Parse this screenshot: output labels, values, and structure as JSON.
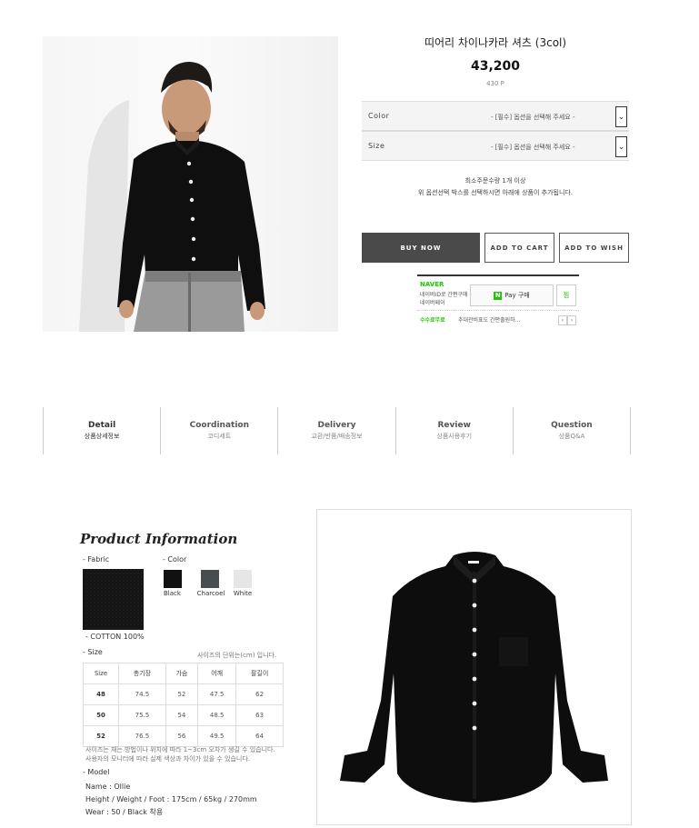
{
  "product": {
    "name": "띠어리 차이나카라 셔츠 (3col)",
    "price": "43,200",
    "points": "430 P"
  },
  "options": [
    {
      "label": "Color",
      "value": "- [필수] 옵션을 선택해 주세요 -"
    },
    {
      "label": "Size",
      "value": "- [필수] 옵션을 선택해 주세요 -"
    }
  ],
  "notice": {
    "line1": "최소주문수량 1개 이상",
    "line2": "위 옵션선택 박스를 선택하시면 아래에 상품이 추가됩니다."
  },
  "buttons": {
    "buy": "BUY NOW",
    "cart": "ADD TO CART",
    "wish": "ADD TO WISH"
  },
  "npay": {
    "brand": "NAVER",
    "line1": "네이버ID로 간편구매",
    "line2": "네이버페이",
    "pay_label": "Pay 구매",
    "pay_n": "N",
    "jjim": "찜",
    "sale_label": "수수료무료",
    "sale_text": "추대관비표도 간편출원하…",
    "prev": "‹",
    "next": "›"
  },
  "tabs": [
    {
      "en": "Detail",
      "ko": "상품상세정보"
    },
    {
      "en": "Coordination",
      "ko": "코디세트"
    },
    {
      "en": "Delivery",
      "ko": "교환/반품/배송정보"
    },
    {
      "en": "Review",
      "ko": "상품사용후기"
    },
    {
      "en": "Question",
      "ko": "상품Q&A"
    }
  ],
  "info": {
    "title": "Product Information",
    "fabric_label": "- Fabric",
    "fabric_value": "- COTTON 100%",
    "color_label": "- Color",
    "colors": [
      {
        "name": "Black",
        "hex": "#111111"
      },
      {
        "name": "Charcoel",
        "hex": "#4a4d50"
      },
      {
        "name": "White",
        "hex": "#e6e6e6"
      }
    ],
    "size_label": "- Size",
    "size_unit": "사이즈의 단위는(cm) 입니다.",
    "size_headers": [
      "Size",
      "총기장",
      "가슴",
      "어깨",
      "팔길이"
    ],
    "size_rows": [
      [
        "48",
        "74.5",
        "52",
        "47.5",
        "62"
      ],
      [
        "50",
        "75.5",
        "54",
        "48.5",
        "63"
      ],
      [
        "52",
        "76.5",
        "56",
        "49.5",
        "64"
      ]
    ],
    "note1": "사이즈는 재는 방법이나 위치에 따라 1~3cm 오차가 생길 수 있습니다.",
    "note2": "사용자의 모니터에 따라 실제 색상과 차이가 있을 수 있습니다.",
    "model_label": "- Model",
    "model_name": "Name : Ollie",
    "model_hwf": "Height / Weight / Foot : 175cm / 65kg / 270mm",
    "model_wear": "Wear : 50 / Black 착용"
  }
}
